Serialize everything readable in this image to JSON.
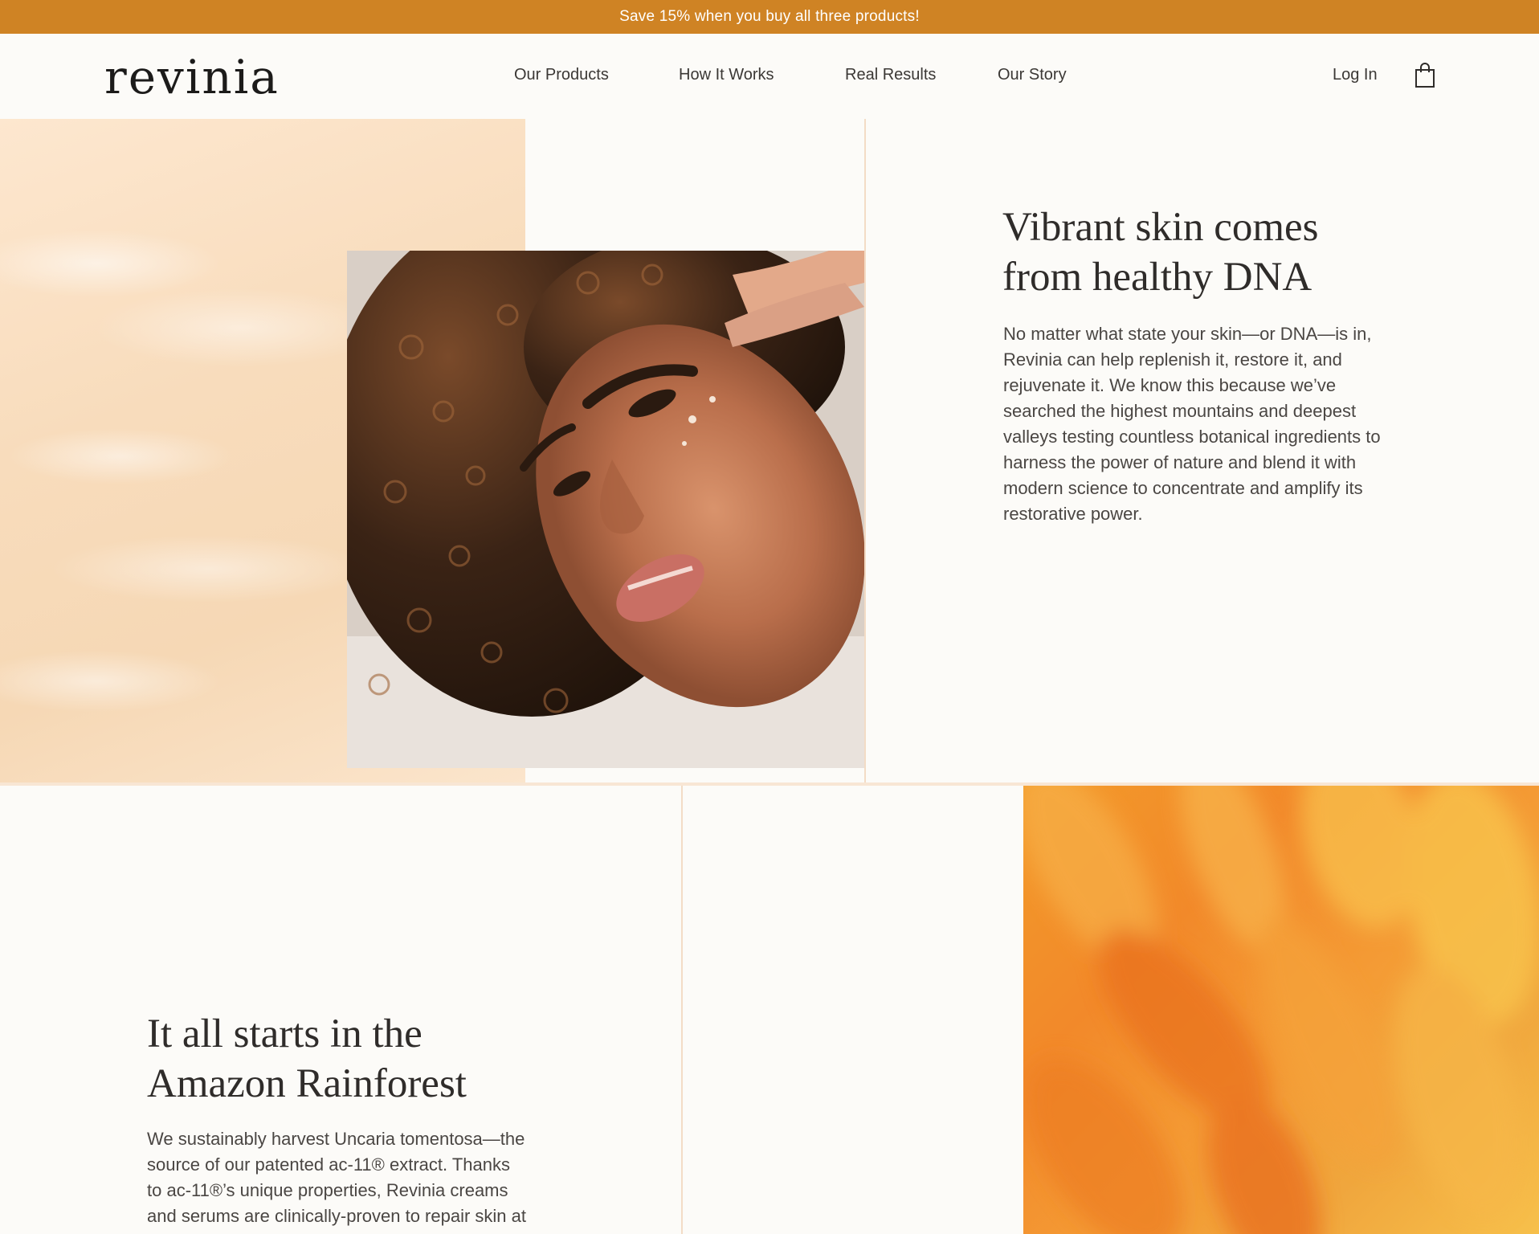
{
  "promo": {
    "text": "Save 15% when you buy all three products!"
  },
  "header": {
    "logo": "revinia",
    "nav": [
      "Our Products",
      "How It Works",
      "Real Results",
      "Our Story"
    ],
    "login": "Log In",
    "cart_icon": "shopping-bag-icon"
  },
  "section1": {
    "headline_line1": "Vibrant skin comes",
    "headline_line2": "from healthy DNA",
    "body": [
      "No matter what state your skin—or DNA—is in,",
      "Revinia can help replenish it, restore it, and",
      "rejuvenate it. We know this because we’ve",
      "searched the highest mountains and deepest",
      "valleys testing countless botanical ingredients to",
      "harness the power of nature and blend it with",
      "modern science to concentrate and amplify its",
      "restorative power."
    ]
  },
  "section2": {
    "headline_line1": "It all starts in the",
    "headline_line2": "Amazon Rainforest",
    "body": [
      "We sustainably harvest Uncaria tomentosa—the",
      "source of our patented ac-11® extract. Thanks",
      "to ac-11®’s unique properties, Revinia creams",
      "and serums are clinically-proven to repair skin at"
    ]
  },
  "colors": {
    "promo_bg": "#cf8324",
    "page_bg": "#fcfbf8",
    "accent_orange": "#f2892a",
    "peach": "#f8dcbc"
  }
}
